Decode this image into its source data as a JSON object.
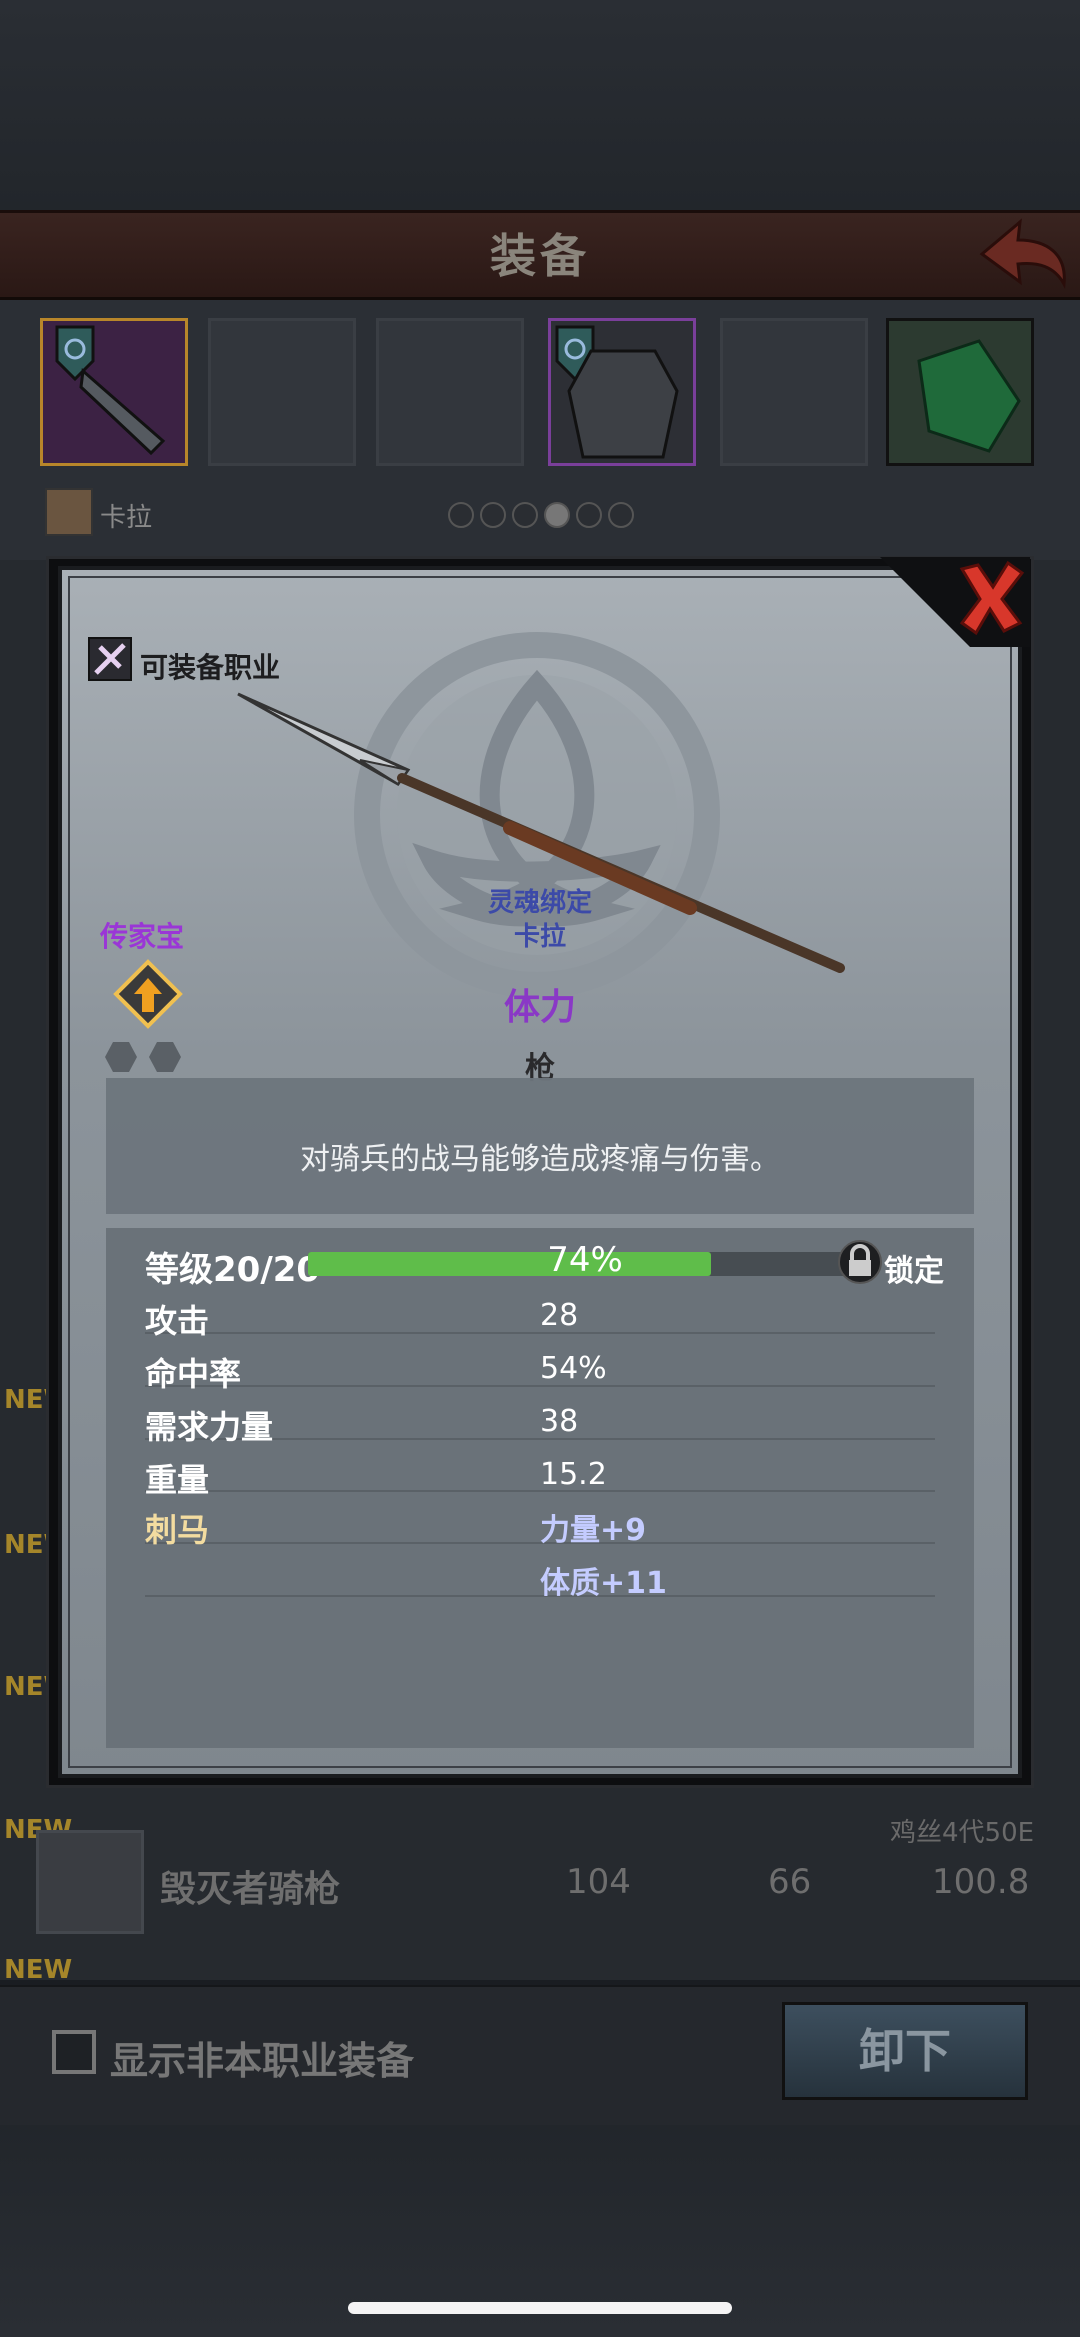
{
  "header": {
    "title": "装备"
  },
  "character": {
    "name": "卡拉",
    "page_dots": 6,
    "page_active": 4
  },
  "background_list": {
    "new_tag": "NEW",
    "row": {
      "name": "毁灭者骑枪",
      "values": [
        "104",
        "66",
        "100.8"
      ],
      "sub": "鸡丝4代50E"
    },
    "show_other_class_label": "显示非本职业装备",
    "unequip_label": "卸下"
  },
  "item": {
    "class_label": "可装备职业",
    "soul_bind_label": "灵魂绑定",
    "soul_bind_owner": "卡拉",
    "stat_type": "体力",
    "weapon_type": "枪",
    "heirloom_label": "传家宝",
    "description": "对骑兵的战马能够造成疼痛与伤害。",
    "level_label": "等级20/20",
    "xp_percent_label": "74%",
    "xp_fraction": 0.74,
    "lock_label": "锁定",
    "stats": [
      {
        "label": "攻击",
        "value": "28"
      },
      {
        "label": "命中率",
        "value": "54%"
      },
      {
        "label": "需求力量",
        "value": "38"
      },
      {
        "label": "重量",
        "value": "15.2"
      }
    ],
    "perk": {
      "label": "刺马",
      "values": [
        "力量+9",
        "体质+11"
      ]
    }
  },
  "colors": {
    "accent_purple": "#8a38c6",
    "xp_green": "#5fbd4a",
    "close_red": "#d8372b",
    "perk_gold": "#f3dca0"
  },
  "icons": [
    "back-arrow-icon",
    "shield-icon",
    "close-icon",
    "class-icon",
    "heirloom-icon",
    "lock-icon",
    "spear-icon"
  ]
}
